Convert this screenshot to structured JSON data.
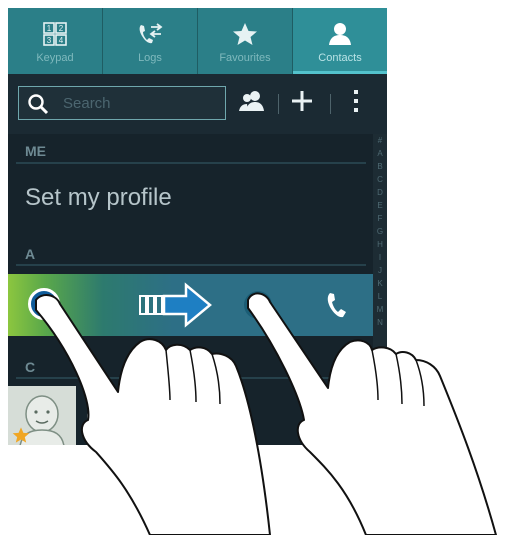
{
  "tabs": [
    {
      "label": "Keypad",
      "icon": "keypad-icon"
    },
    {
      "label": "Logs",
      "icon": "logs-icon"
    },
    {
      "label": "Favourites",
      "icon": "star-icon"
    },
    {
      "label": "Contacts",
      "icon": "contact-icon",
      "active": true
    }
  ],
  "search": {
    "placeholder": "Search"
  },
  "sections": {
    "me": "ME",
    "a": "A",
    "c": "C"
  },
  "profile_label": "Set my profile",
  "index_letters": [
    "#",
    "A",
    "B",
    "C",
    "D",
    "E",
    "F",
    "G",
    "H",
    "I",
    "J",
    "K",
    "L",
    "M",
    "N"
  ],
  "colors": {
    "accent": "#2f8f98",
    "swipe_green": "#8cc63f",
    "swipe_blue": "#2d6f86",
    "arrow_blue": "#1e7fc3"
  }
}
